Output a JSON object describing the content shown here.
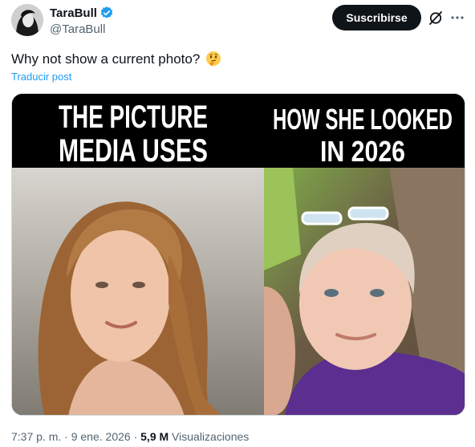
{
  "author": {
    "name": "TaraBull",
    "handle": "@TaraBull",
    "verified_color": "#1d9bf0"
  },
  "actions": {
    "subscribe_label": "Suscribirse",
    "grok_icon": "grok-icon",
    "more_icon": "more-icon"
  },
  "post": {
    "text": "Why not show a current photo?",
    "emoji": "thinking-face",
    "translate_label": "Traducir post"
  },
  "media": {
    "left_caption_line1": "THE PICTURE",
    "left_caption_line2": "MEDIA USES",
    "right_caption_line1": "HOW SHE LOOKED",
    "right_caption_line2": "IN 2026"
  },
  "footer": {
    "time": "7:37 p. m.",
    "date": "9 ene. 2026",
    "views_count": "5,9 M",
    "views_label": "Visualizaciones",
    "separator": "·"
  }
}
